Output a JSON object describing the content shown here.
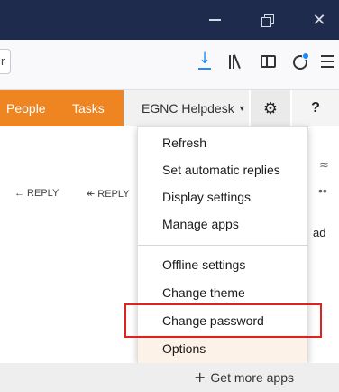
{
  "window": {
    "minimize_glyph": "",
    "close_glyph": "✕"
  },
  "toolbar": {
    "url_fragment": "r",
    "icons": [
      "download-icon",
      "library-icon",
      "sidebar-icon",
      "extension-icon",
      "menu-icon"
    ]
  },
  "nav": {
    "people": "People",
    "tasks": "Tasks",
    "helpdesk": "EGNC Helpdesk",
    "caret": "▾",
    "gear_glyph": "⚙",
    "help_glyph": "?"
  },
  "background": {
    "reply1": "← REPLY",
    "reply2": "↞ REPLY",
    "ad": "ad",
    "expand": "≈",
    "dots": "••"
  },
  "menu": {
    "items": [
      "Refresh",
      "Set automatic replies",
      "Display settings",
      "Manage apps",
      "Offline settings",
      "Change theme",
      "Change password",
      "Options"
    ],
    "highlighted": "Change password",
    "hovered": "Options"
  },
  "bottom": {
    "get_more_apps": "Get more apps",
    "plus": "+"
  },
  "colors": {
    "titlebar": "#1f2b4d",
    "nav_accent": "#ef8520",
    "download_blue": "#1a8cff",
    "highlight_red": "#e0211f"
  }
}
